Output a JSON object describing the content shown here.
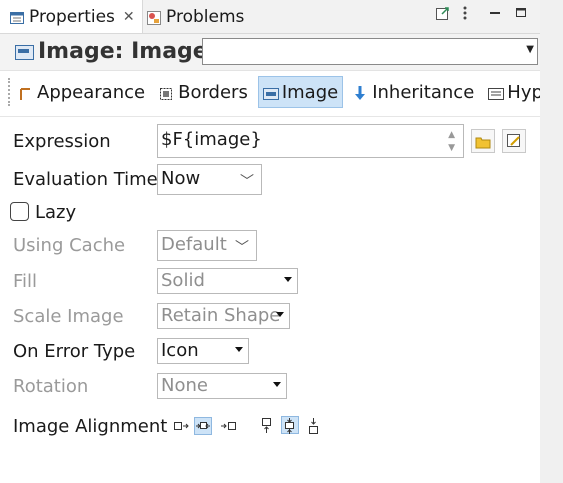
{
  "tabs": {
    "properties_label": "Properties",
    "close_glyph": "✕",
    "problems_label": "Problems"
  },
  "header": {
    "title": "Image: Image",
    "combo_value": ""
  },
  "subtabs": [
    {
      "label": "Appearance",
      "icon": "appearance-icon"
    },
    {
      "label": "Borders",
      "icon": "borders-icon"
    },
    {
      "label": "Image",
      "icon": "image-icon",
      "selected": true
    },
    {
      "label": "Inheritance",
      "icon": "inheritance-icon"
    },
    {
      "label": "Hyperl",
      "icon": "hyperlink-icon"
    }
  ],
  "props": {
    "expression_label": "Expression",
    "expression_value": "$F{image}",
    "evaluation_time_label": "Evaluation Time",
    "evaluation_time_value": "Now",
    "lazy_label": "Lazy",
    "using_cache_label": "Using Cache",
    "using_cache_value": "Default",
    "fill_label": "Fill",
    "fill_value": "Solid",
    "scale_image_label": "Scale Image",
    "scale_image_value": "Retain Shape",
    "on_error_type_label": "On Error Type",
    "on_error_type_value": "Icon",
    "rotation_label": "Rotation",
    "rotation_value": "None",
    "image_alignment_label": "Image Alignment"
  },
  "colors": {
    "selected_bg": "#cde3f7",
    "selected_border": "#9cc3e8",
    "disabled_text": "#9a9a9a"
  }
}
